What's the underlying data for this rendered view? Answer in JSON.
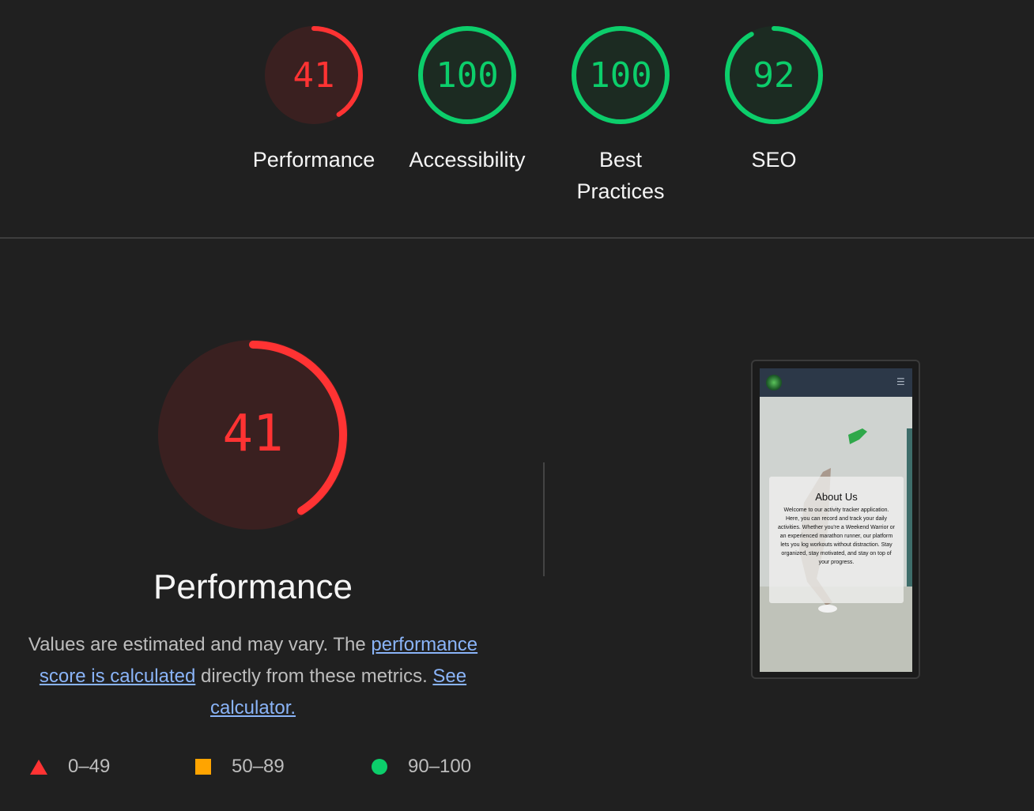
{
  "colors": {
    "background": "#202020",
    "fail": "#ff3333",
    "fail_bg": "#3a2020",
    "average": "#ffa400",
    "pass": "#0cce6b",
    "pass_bg": "#1c2b22",
    "link": "#8ab4f8"
  },
  "scores": [
    {
      "id": "performance",
      "value": "41",
      "score": 41,
      "label": "Performance",
      "status": "fail"
    },
    {
      "id": "accessibility",
      "value": "100",
      "score": 100,
      "label": "Accessibility",
      "status": "pass"
    },
    {
      "id": "best-practices",
      "value": "100",
      "score": 100,
      "label": "Best Practices",
      "status": "pass"
    },
    {
      "id": "seo",
      "value": "92",
      "score": 92,
      "label": "SEO",
      "status": "pass"
    }
  ],
  "main": {
    "value": "41",
    "score": 41,
    "title": "Performance",
    "description_prefix": "Values are estimated and may vary. The ",
    "link_score": "performance score is calculated",
    "description_middle": " directly from these metrics. ",
    "link_calculator": "See calculator."
  },
  "legend": [
    {
      "range": "0–49",
      "icon": "triangle-icon"
    },
    {
      "range": "50–89",
      "icon": "square-icon"
    },
    {
      "range": "90–100",
      "icon": "circle-icon"
    }
  ],
  "screenshot": {
    "card_title": "About Us",
    "card_body": "Welcome to our activity tracker application. Here, you can record and track your daily activities. Whether you're a Weekend Warrior or an experienced marathon runner, our platform lets you log workouts without distraction. Stay organized, stay motivated, and stay on top of your progress."
  }
}
